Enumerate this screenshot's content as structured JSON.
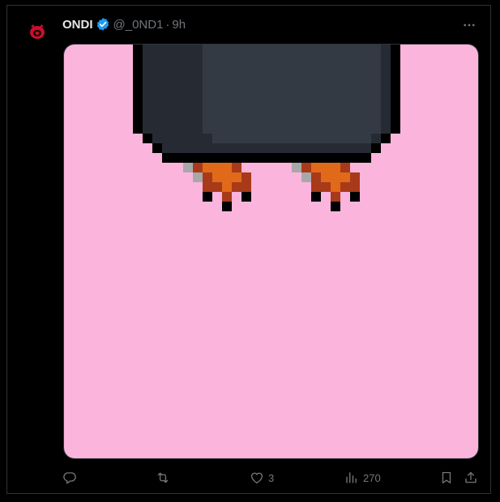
{
  "post": {
    "author": {
      "name": "ONDI",
      "handle": "@_0ND1",
      "separator": "·",
      "time": "9h",
      "verified": true,
      "avatar_icon": "red-creature-avatar"
    },
    "more_icon": "more-horizontal-icon",
    "media": {
      "background_color": "#fbb5dd",
      "description_icon": "pixel-art-dark-creature-with-orange-feet"
    },
    "actions": {
      "reply": {
        "icon": "reply-icon",
        "count": ""
      },
      "repost": {
        "icon": "repost-icon",
        "count": ""
      },
      "like": {
        "icon": "heart-icon",
        "count": "3"
      },
      "views": {
        "icon": "views-icon",
        "count": "270"
      },
      "bookmark": {
        "icon": "bookmark-icon"
      },
      "share": {
        "icon": "share-icon"
      }
    }
  },
  "colors": {
    "background": "#000000",
    "text_primary": "#e7e9ea",
    "text_secondary": "#71767b",
    "verified_blue": "#1d9bf0",
    "border": "#2f3336"
  }
}
